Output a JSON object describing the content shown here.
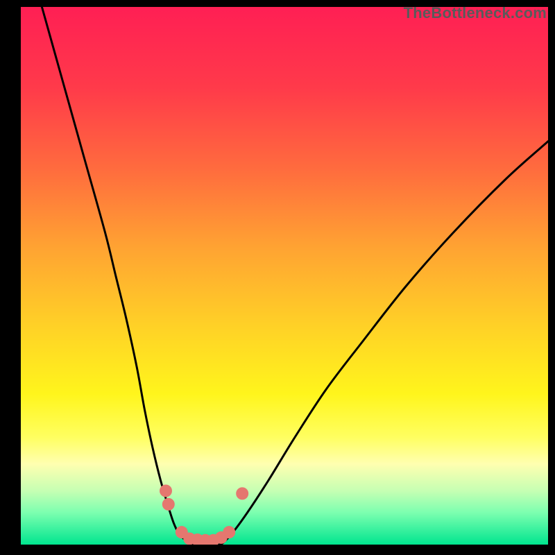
{
  "watermark": "TheBottleneck.com",
  "chart_data": {
    "type": "line",
    "title": "",
    "xlabel": "",
    "ylabel": "",
    "xlim": [
      0,
      100
    ],
    "ylim": [
      0,
      100
    ],
    "grid": false,
    "legend": false,
    "background_gradient": {
      "stops": [
        {
          "offset": 0.0,
          "color": "#ff1f54"
        },
        {
          "offset": 0.15,
          "color": "#ff3a4a"
        },
        {
          "offset": 0.3,
          "color": "#ff6b3e"
        },
        {
          "offset": 0.45,
          "color": "#ffa432"
        },
        {
          "offset": 0.6,
          "color": "#ffd326"
        },
        {
          "offset": 0.72,
          "color": "#fff51c"
        },
        {
          "offset": 0.8,
          "color": "#ffff60"
        },
        {
          "offset": 0.85,
          "color": "#ffffb0"
        },
        {
          "offset": 0.9,
          "color": "#c6ffb3"
        },
        {
          "offset": 0.94,
          "color": "#7dffb0"
        },
        {
          "offset": 1.0,
          "color": "#00e58f"
        }
      ]
    },
    "series": [
      {
        "name": "curve-left",
        "stroke": "#000000",
        "x": [
          4,
          8,
          12,
          16,
          18,
          20,
          22,
          23.5,
          25,
          26.5,
          28,
          29,
          30,
          31,
          32
        ],
        "y": [
          100,
          86,
          72,
          58,
          50,
          42,
          33,
          25,
          18,
          12,
          7,
          4,
          2,
          1,
          0
        ]
      },
      {
        "name": "curve-right",
        "stroke": "#000000",
        "x": [
          38,
          40,
          43,
          47,
          52,
          58,
          65,
          73,
          82,
          92,
          100
        ],
        "y": [
          0,
          2,
          6,
          12,
          20,
          29,
          38,
          48,
          58,
          68,
          75
        ]
      },
      {
        "name": "curve-bottom",
        "stroke": "#000000",
        "x": [
          32,
          33,
          34,
          35,
          36,
          37,
          38
        ],
        "y": [
          0,
          0,
          0,
          0,
          0,
          0,
          0
        ]
      }
    ],
    "markers": {
      "name": "dots",
      "color": "#e5776f",
      "radius": 9,
      "points": [
        {
          "x": 27.5,
          "y": 10
        },
        {
          "x": 28.0,
          "y": 7.5
        },
        {
          "x": 30.5,
          "y": 2.3
        },
        {
          "x": 32.0,
          "y": 1.1
        },
        {
          "x": 33.5,
          "y": 0.9
        },
        {
          "x": 35.0,
          "y": 0.8
        },
        {
          "x": 36.5,
          "y": 0.8
        },
        {
          "x": 38.0,
          "y": 1.3
        },
        {
          "x": 39.5,
          "y": 2.3
        },
        {
          "x": 42.0,
          "y": 9.5
        }
      ]
    }
  }
}
